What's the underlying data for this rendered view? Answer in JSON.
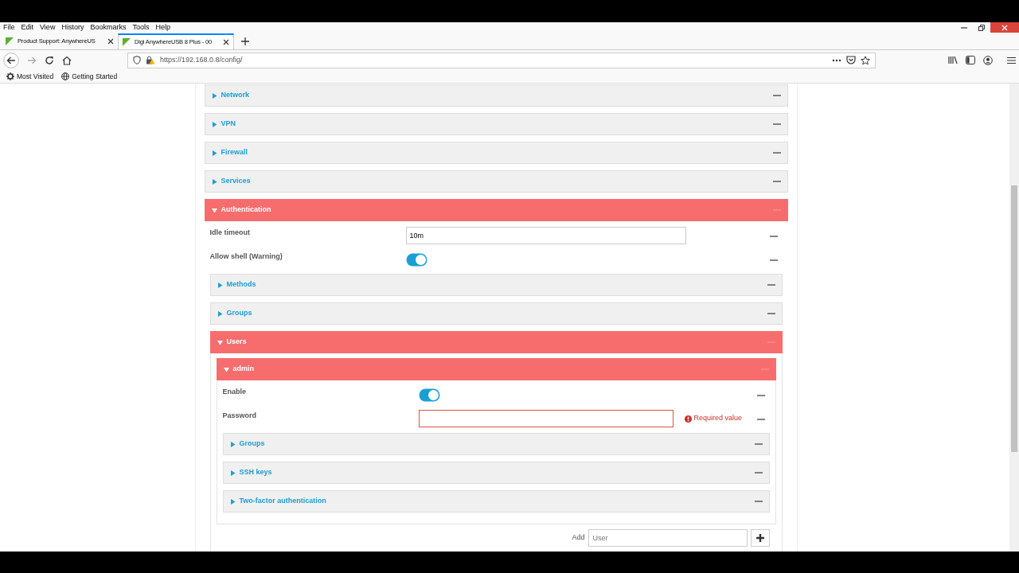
{
  "browser": {
    "menu": [
      "File",
      "Edit",
      "View",
      "History",
      "Bookmarks",
      "Tools",
      "Help"
    ],
    "tabs": [
      {
        "label": "Product Support: AnywhereUS",
        "selected": false
      },
      {
        "label": "Digi AnywhereUSB 8 Plus - 00",
        "selected": true
      }
    ],
    "url": "https://192.168.0.8/config/",
    "bookmarks": [
      "Most Visited",
      "Getting Started"
    ]
  },
  "sections": [
    {
      "title": "Network",
      "expanded": false
    },
    {
      "title": "VPN",
      "expanded": false
    },
    {
      "title": "Firewall",
      "expanded": false
    },
    {
      "title": "Services",
      "expanded": false
    },
    {
      "title": "Authentication",
      "expanded": true,
      "fields": [
        {
          "kind": "text",
          "label": "Idle timeout",
          "value": "10m"
        },
        {
          "kind": "toggle",
          "label": "Allow shell (Warning)",
          "on": true
        }
      ],
      "children": [
        {
          "title": "Methods",
          "expanded": false
        },
        {
          "title": "Groups",
          "expanded": false
        },
        {
          "title": "Users",
          "expanded": true,
          "children": [
            {
              "title": "admin",
              "expanded": true,
              "fields": [
                {
                  "kind": "toggle",
                  "label": "Enable",
                  "on": true
                },
                {
                  "kind": "password",
                  "label": "Password",
                  "error": "Required value"
                }
              ],
              "children": [
                {
                  "title": "Groups",
                  "expanded": false
                },
                {
                  "title": "SSH keys",
                  "expanded": false
                },
                {
                  "title": "Two-factor authentication",
                  "expanded": false
                }
              ]
            }
          ],
          "add": {
            "label": "Add",
            "placeholder": "User"
          }
        }
      ]
    }
  ]
}
